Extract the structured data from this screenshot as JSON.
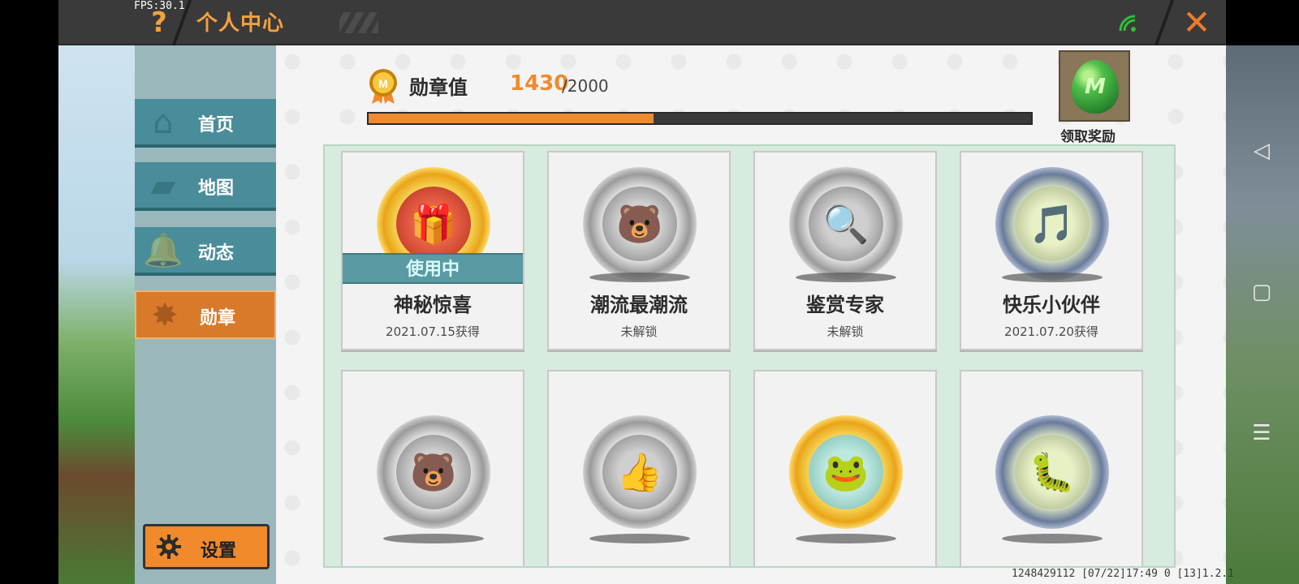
{
  "status": {
    "fps": "FPS:30.1"
  },
  "header": {
    "title": "个人中心",
    "help_glyph": "?",
    "close_glyph": "✕"
  },
  "sidebar": {
    "items": [
      {
        "label": "首页",
        "icon": "home-icon",
        "active": false
      },
      {
        "label": "地图",
        "icon": "map-icon",
        "active": false
      },
      {
        "label": "动态",
        "icon": "bell-icon",
        "active": false
      },
      {
        "label": "勋章",
        "icon": "medal-icon",
        "active": true
      }
    ],
    "settings_label": "设置"
  },
  "progress": {
    "label": "勋章值",
    "value": "1430",
    "max": "/2000",
    "fraction": 0.43
  },
  "reward": {
    "label": "领取奖励"
  },
  "badges": [
    {
      "name": "神秘惊喜",
      "sub": "2021.07.15获得",
      "status": "使用中",
      "style": "gold",
      "glyph": "🎁"
    },
    {
      "name": "潮流最潮流",
      "sub": "未解锁",
      "style": "gray",
      "glyph": "🐻"
    },
    {
      "name": "鉴赏专家",
      "sub": "未解锁",
      "style": "gray",
      "glyph": "🔍"
    },
    {
      "name": "快乐小伙伴",
      "sub": "2021.07.20获得",
      "style": "steel",
      "glyph": "🎵"
    },
    {
      "name": "",
      "sub": "",
      "style": "gray",
      "glyph": "🐻"
    },
    {
      "name": "",
      "sub": "",
      "style": "gray",
      "glyph": "👍"
    },
    {
      "name": "",
      "sub": "",
      "style": "gold",
      "glyph": "🐸"
    },
    {
      "name": "",
      "sub": "",
      "style": "steel",
      "glyph": "🐛"
    }
  ],
  "footer": {
    "info": "1248429112   [07/22]17:49 0  [13]1.2.1"
  },
  "colors": {
    "accent": "#f08a2c",
    "sidebar": "#4a8d9a",
    "panel": "#f4f4f4"
  }
}
